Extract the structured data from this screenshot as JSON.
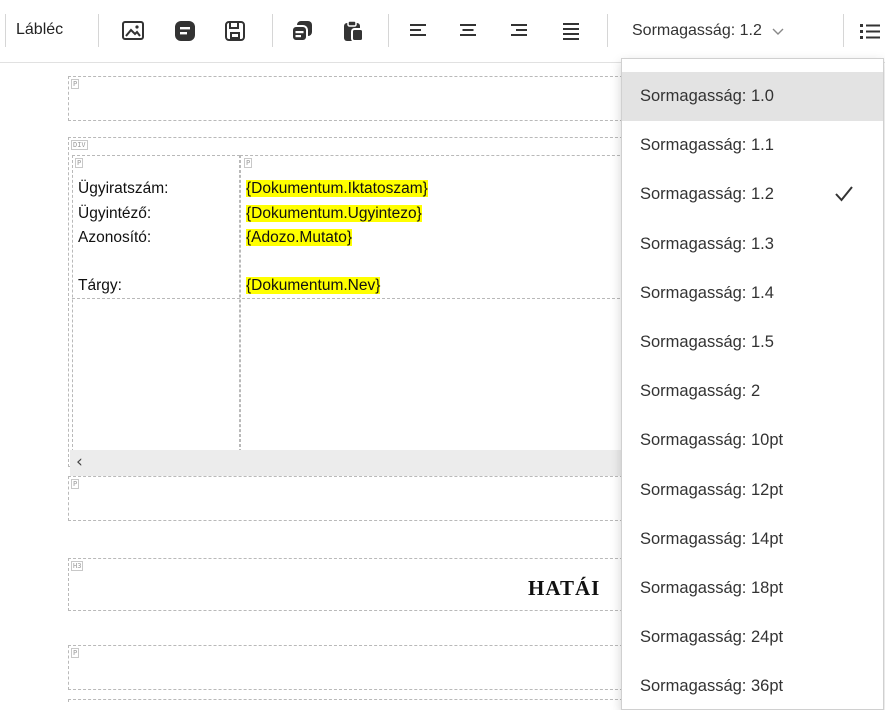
{
  "toolbar": {
    "footer_label": "Lábléc",
    "line_height_label": "Sormagasság: 1.2",
    "chevron": "⌵"
  },
  "document": {
    "field_labels": [
      "Ügyiratszám:",
      "Ügyintéző:",
      "Azonosító:",
      "Tárgy:"
    ],
    "field_values": [
      "{Dokumentum.Iktatoszam}",
      "{Dokumentum.Ugyintezo}",
      "{Adozo.Mutato}",
      "{Dokumentum.Nev}"
    ],
    "block_tags": {
      "p": "P",
      "div": "DIV",
      "h3": "H3"
    },
    "heading_visible": "HATÁI"
  },
  "dropdown": {
    "selected_index": 2,
    "hover_index": 0,
    "options": [
      "Sormagasság: 1.0",
      "Sormagasság: 1.1",
      "Sormagasság: 1.2",
      "Sormagasság: 1.3",
      "Sormagasság: 1.4",
      "Sormagasság: 1.5",
      "Sormagasság: 2",
      "Sormagasság: 10pt",
      "Sormagasság: 12pt",
      "Sormagasság: 14pt",
      "Sormagasság: 18pt",
      "Sormagasság: 24pt",
      "Sormagasság: 36pt"
    ]
  },
  "colors": {
    "highlight": "#ffff00",
    "hover_bg": "#e3e3e3"
  }
}
